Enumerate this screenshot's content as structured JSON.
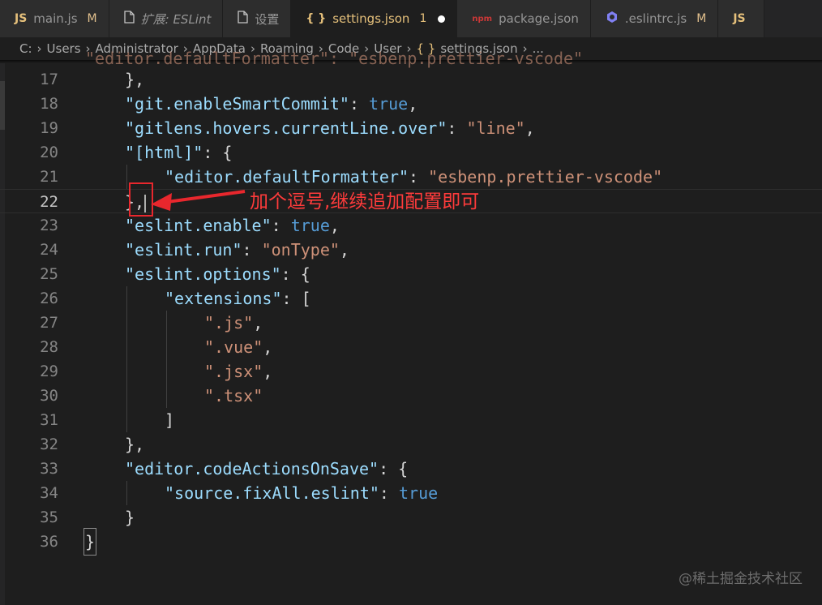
{
  "tabs": [
    {
      "icon_text": "JS",
      "label": "main.js",
      "mod": "M",
      "active": false
    },
    {
      "icon_name": "file-icon",
      "label": "扩展: ESLint",
      "italic": true,
      "active": false
    },
    {
      "icon_name": "file-icon",
      "label": "设置",
      "active": false
    },
    {
      "icon_text": "{ }",
      "label": "settings.json",
      "mod": "1",
      "active": true,
      "unsaved": true
    },
    {
      "icon_text": "npm",
      "label": "package.json",
      "active": false
    },
    {
      "icon_name": "eslint-icon",
      "label": ".eslintrc.js",
      "mod": "M",
      "active": false
    },
    {
      "icon_text": "JS",
      "label": "",
      "active": false
    }
  ],
  "breadcrumb": {
    "items": [
      "C:",
      "Users",
      "Administrator",
      "AppData",
      "Roaming",
      "Code",
      "User"
    ],
    "file_icon": "{ }",
    "file": "settings.json",
    "ellipsis": "..."
  },
  "editor": {
    "current_line": 22,
    "top_partial": "\"editor.defaultFormatter\": \"esbenp.prettier-vscode\"",
    "lines": [
      {
        "n": "17",
        "indent": 1,
        "tokens": [
          [
            "p",
            "},"
          ]
        ]
      },
      {
        "n": "18",
        "indent": 1,
        "tokens": [
          [
            "k",
            "\"git.enableSmartCommit\""
          ],
          [
            "p",
            ": "
          ],
          [
            "b",
            "true"
          ],
          [
            "p",
            ","
          ]
        ]
      },
      {
        "n": "19",
        "indent": 1,
        "tokens": [
          [
            "k",
            "\"gitlens.hovers.currentLine.over\""
          ],
          [
            "p",
            ": "
          ],
          [
            "s",
            "\"line\""
          ],
          [
            "p",
            ","
          ]
        ]
      },
      {
        "n": "20",
        "indent": 1,
        "tokens": [
          [
            "k",
            "\"[html]\""
          ],
          [
            "p",
            ": {"
          ]
        ]
      },
      {
        "n": "21",
        "indent": 2,
        "tokens": [
          [
            "k",
            "\"editor.defaultFormatter\""
          ],
          [
            "p",
            ": "
          ],
          [
            "s",
            "\"esbenp.prettier-vscode\""
          ]
        ]
      },
      {
        "n": "22",
        "indent": 1,
        "tokens": [
          [
            "p",
            "},"
          ]
        ],
        "cursor": true
      },
      {
        "n": "23",
        "indent": 1,
        "tokens": [
          [
            "k",
            "\"eslint.enable\""
          ],
          [
            "p",
            ": "
          ],
          [
            "b",
            "true"
          ],
          [
            "p",
            ","
          ]
        ]
      },
      {
        "n": "24",
        "indent": 1,
        "tokens": [
          [
            "k",
            "\"eslint.run\""
          ],
          [
            "p",
            ": "
          ],
          [
            "s",
            "\"onType\""
          ],
          [
            "p",
            ","
          ]
        ]
      },
      {
        "n": "25",
        "indent": 1,
        "tokens": [
          [
            "k",
            "\"eslint.options\""
          ],
          [
            "p",
            ": {"
          ]
        ]
      },
      {
        "n": "26",
        "indent": 2,
        "tokens": [
          [
            "k",
            "\"extensions\""
          ],
          [
            "p",
            ": ["
          ]
        ]
      },
      {
        "n": "27",
        "indent": 3,
        "tokens": [
          [
            "s",
            "\".js\""
          ],
          [
            "p",
            ","
          ]
        ]
      },
      {
        "n": "28",
        "indent": 3,
        "tokens": [
          [
            "s",
            "\".vue\""
          ],
          [
            "p",
            ","
          ]
        ]
      },
      {
        "n": "29",
        "indent": 3,
        "tokens": [
          [
            "s",
            "\".jsx\""
          ],
          [
            "p",
            ","
          ]
        ]
      },
      {
        "n": "30",
        "indent": 3,
        "tokens": [
          [
            "s",
            "\".tsx\""
          ]
        ]
      },
      {
        "n": "31",
        "indent": 2,
        "tokens": [
          [
            "p",
            "]"
          ]
        ]
      },
      {
        "n": "32",
        "indent": 1,
        "tokens": [
          [
            "p",
            "},"
          ]
        ]
      },
      {
        "n": "33",
        "indent": 1,
        "tokens": [
          [
            "k",
            "\"editor.codeActionsOnSave\""
          ],
          [
            "p",
            ": {"
          ]
        ]
      },
      {
        "n": "34",
        "indent": 2,
        "tokens": [
          [
            "k",
            "\"source.fixAll.eslint\""
          ],
          [
            "p",
            ": "
          ],
          [
            "b",
            "true"
          ]
        ]
      },
      {
        "n": "35",
        "indent": 1,
        "tokens": [
          [
            "p",
            "}"
          ]
        ]
      },
      {
        "n": "36",
        "indent": 0,
        "tokens": [
          [
            "p",
            "}"
          ]
        ],
        "cursor_box": true
      }
    ]
  },
  "annotation": {
    "text": "加个逗号,继续追加配置即可",
    "color": "#ff3b3b"
  },
  "watermark": "@稀土掘金技术社区",
  "colors": {
    "key": "#9cdcfe",
    "string": "#ce9178",
    "boolean": "#569cd6",
    "punct": "#d4d4d4",
    "background": "#1e1e1e"
  }
}
